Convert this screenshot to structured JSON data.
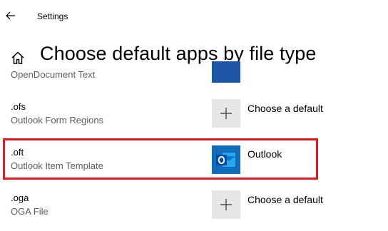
{
  "window": {
    "title": "Settings"
  },
  "page": {
    "title": "Choose default apps by file type"
  },
  "rows": [
    {
      "ext": "",
      "desc": "OpenDocument Text",
      "app": ""
    },
    {
      "ext": ".ofs",
      "desc": "Outlook Form Regions",
      "app": "Choose a default"
    },
    {
      "ext": ".oft",
      "desc": "Outlook Item Template",
      "app": "Outlook"
    },
    {
      "ext": ".oga",
      "desc": "OGA File",
      "app": "Choose a default"
    }
  ],
  "colors": {
    "highlight": "#e0181f",
    "outlook_blue": "#0f6cbd",
    "tile_gray": "#e6e6e6"
  }
}
